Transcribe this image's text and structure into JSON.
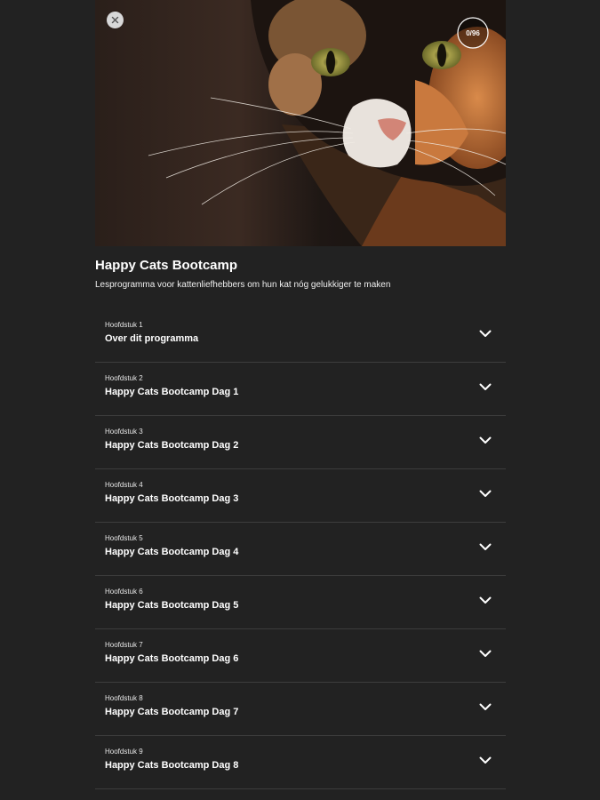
{
  "header": {
    "progress": "0/96",
    "close_icon": "close-icon"
  },
  "program": {
    "title": "Happy Cats Bootcamp",
    "subtitle": "Lesprogramma voor kattenliefhebbers om hun kat nóg gelukkiger te maken"
  },
  "chapters": [
    {
      "number": "Hoofdstuk 1",
      "title": "Over dit programma"
    },
    {
      "number": "Hoofdstuk 2",
      "title": "Happy Cats Bootcamp Dag 1"
    },
    {
      "number": "Hoofdstuk 3",
      "title": "Happy Cats Bootcamp Dag 2"
    },
    {
      "number": "Hoofdstuk 4",
      "title": "Happy Cats Bootcamp Dag 3"
    },
    {
      "number": "Hoofdstuk 5",
      "title": "Happy Cats Bootcamp Dag 4"
    },
    {
      "number": "Hoofdstuk 6",
      "title": "Happy Cats Bootcamp Dag 5"
    },
    {
      "number": "Hoofdstuk 7",
      "title": "Happy Cats Bootcamp Dag 6"
    },
    {
      "number": "Hoofdstuk 8",
      "title": "Happy Cats Bootcamp Dag 7"
    },
    {
      "number": "Hoofdstuk 9",
      "title": "Happy Cats Bootcamp Dag 8"
    }
  ],
  "colors": {
    "background": "#222222",
    "divider": "#3d3d3d",
    "text": "#ffffff"
  }
}
